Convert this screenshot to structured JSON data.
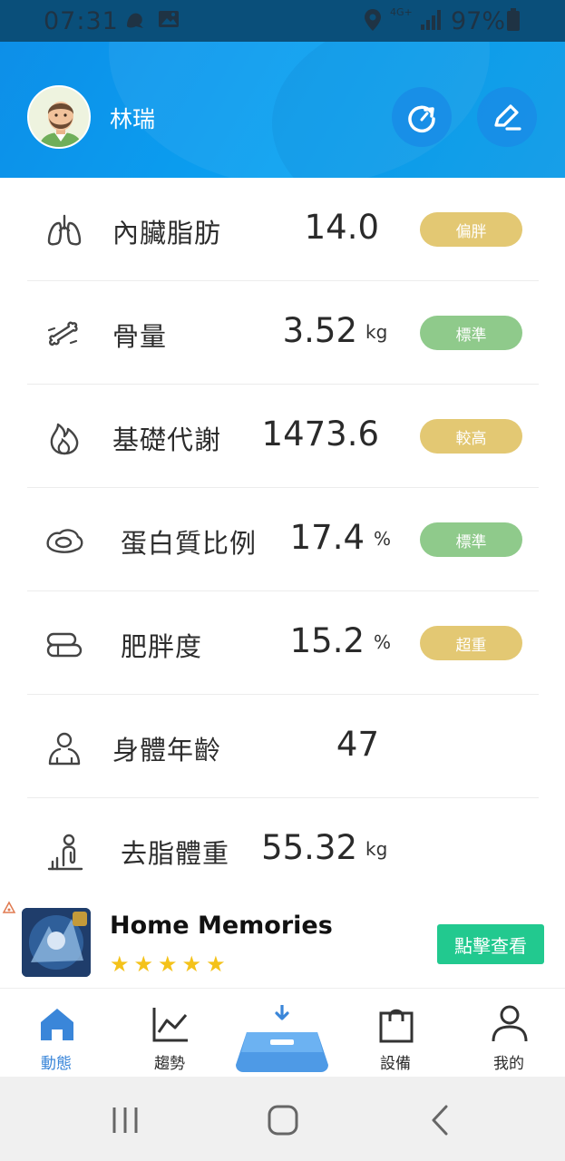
{
  "status_bar": {
    "time": "07:31",
    "network": "4G+",
    "battery_percent": "97%"
  },
  "profile": {
    "name": "林瑞"
  },
  "metrics": [
    {
      "label": "內臟脂肪",
      "value": "14.0",
      "unit": "",
      "badge": "偏胖",
      "badge_color": "#e3c873",
      "icon": "lungs-icon"
    },
    {
      "label": "骨量",
      "value": "3.52",
      "unit": "kg",
      "badge": "標準",
      "badge_color": "#8fca8b",
      "icon": "bone-icon"
    },
    {
      "label": "基礎代謝",
      "value": "1473.6",
      "unit": "",
      "badge": "較高",
      "badge_color": "#e3c873",
      "icon": "flame-icon"
    },
    {
      "label": "蛋白質比例",
      "value": "17.4",
      "unit": "%",
      "badge": "標準",
      "badge_color": "#8fca8b",
      "icon": "egg-icon"
    },
    {
      "label": "肥胖度",
      "value": "15.2",
      "unit": "%",
      "badge": "超重",
      "badge_color": "#e3c873",
      "icon": "fat-roll-icon"
    },
    {
      "label": "身體年齡",
      "value": "47",
      "unit": "",
      "badge": "",
      "badge_color": "",
      "icon": "body-person-icon"
    },
    {
      "label": "去脂體重",
      "value": "55.32",
      "unit": "kg",
      "badge": "",
      "badge_color": "",
      "icon": "muscle-body-icon"
    }
  ],
  "ad": {
    "title": "Home Memories",
    "stars": "★★★★★",
    "button": "點擊查看"
  },
  "bottom_nav": {
    "items": [
      {
        "label": "動態",
        "icon": "home-icon",
        "active": true
      },
      {
        "label": "趨勢",
        "icon": "trend-chart-icon",
        "active": false
      },
      {
        "label": "設備",
        "icon": "shopping-bag-icon",
        "active": false
      },
      {
        "label": "我的",
        "icon": "profile-icon",
        "active": false
      }
    ],
    "center_icon": "scale-measure-icon"
  },
  "colors": {
    "header_blue": "#0aa3f2",
    "active_blue": "#3a86d9",
    "badge_yellow": "#e3c873",
    "badge_green": "#8fca8b",
    "ad_button": "#22c98f"
  }
}
